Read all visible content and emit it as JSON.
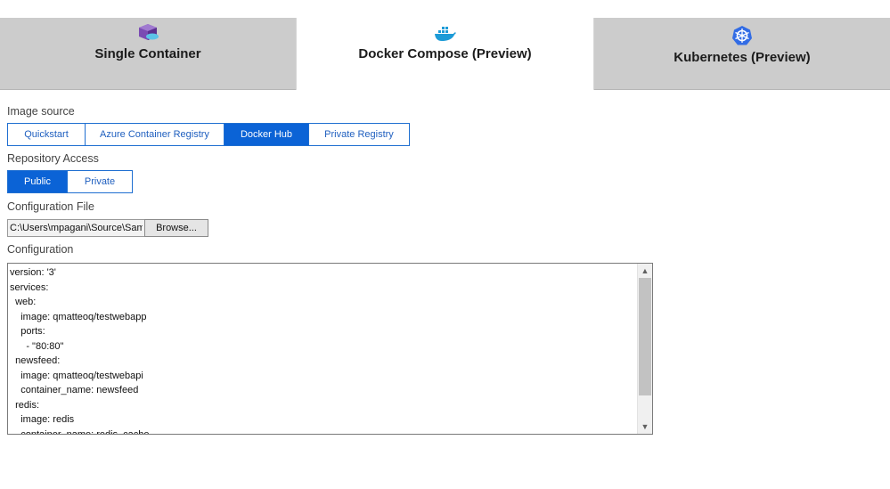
{
  "tabs": [
    {
      "label": "Single Container",
      "icon": "container-cube-icon",
      "active": false
    },
    {
      "label": "Docker Compose (Preview)",
      "icon": "docker-whale-icon",
      "active": true
    },
    {
      "label": "Kubernetes (Preview)",
      "icon": "kubernetes-wheel-icon",
      "active": false
    }
  ],
  "image_source": {
    "label": "Image source",
    "options": [
      "Quickstart",
      "Azure Container Registry",
      "Docker Hub",
      "Private Registry"
    ],
    "selected": "Docker Hub"
  },
  "repository_access": {
    "label": "Repository Access",
    "options": [
      "Public",
      "Private"
    ],
    "selected": "Public"
  },
  "configuration_file": {
    "label": "Configuration File",
    "value": "C:\\Users\\mpagani\\Source\\Samples",
    "browse_label": "Browse..."
  },
  "configuration": {
    "label": "Configuration",
    "text": "version: '3'\nservices:\n  web:\n    image: qmatteoq/testwebapp\n    ports:\n      - \"80:80\"\n  newsfeed:\n    image: qmatteoq/testwebapi\n    container_name: newsfeed\n  redis:\n    image: redis\n    container_name: redis_cache"
  },
  "colors": {
    "accent": "#0b63d6",
    "tab_inactive": "#cccccc",
    "docker_blue": "#1d9bd7",
    "kubernetes_blue": "#326ce5",
    "container_purple": "#6b3fa0"
  }
}
